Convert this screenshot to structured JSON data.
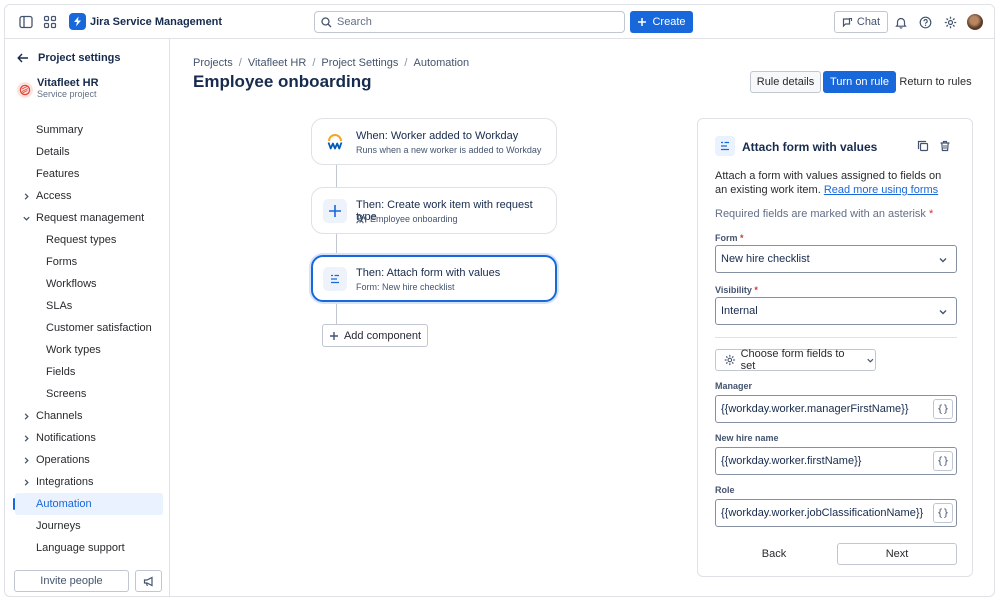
{
  "topbar": {
    "app_name": "Jira Service Management",
    "search_placeholder": "Search",
    "create_label": "Create",
    "chat_label": "Chat"
  },
  "sidebar": {
    "back_title": "Project settings",
    "project_name": "Vitafleet HR",
    "project_type": "Service project",
    "items": [
      {
        "label": "Summary",
        "level": 1
      },
      {
        "label": "Details",
        "level": 1
      },
      {
        "label": "Features",
        "level": 1
      },
      {
        "label": "Access",
        "level": 1,
        "chevron": "right"
      },
      {
        "label": "Request management",
        "level": 1,
        "chevron": "down"
      },
      {
        "label": "Request types",
        "level": 2
      },
      {
        "label": "Forms",
        "level": 2
      },
      {
        "label": "Workflows",
        "level": 2
      },
      {
        "label": "SLAs",
        "level": 2
      },
      {
        "label": "Customer satisfaction",
        "level": 2
      },
      {
        "label": "Work types",
        "level": 2
      },
      {
        "label": "Fields",
        "level": 2
      },
      {
        "label": "Screens",
        "level": 2
      },
      {
        "label": "Channels",
        "level": 1,
        "chevron": "right"
      },
      {
        "label": "Notifications",
        "level": 1,
        "chevron": "right"
      },
      {
        "label": "Operations",
        "level": 1,
        "chevron": "right"
      },
      {
        "label": "Integrations",
        "level": 1,
        "chevron": "right"
      },
      {
        "label": "Automation",
        "level": 1,
        "active": true
      },
      {
        "label": "Journeys",
        "level": 1
      },
      {
        "label": "Language support",
        "level": 1
      }
    ],
    "invite_label": "Invite people"
  },
  "main": {
    "breadcrumb": [
      "Projects",
      "Vitafleet HR",
      "Project Settings",
      "Automation"
    ],
    "breadcrumb_sep": "/",
    "title": "Employee onboarding",
    "rule_details_label": "Rule details",
    "turn_on_label": "Turn on rule",
    "return_label": "Return to rules"
  },
  "flow": {
    "trigger": {
      "title": "When: Worker added to Workday",
      "subtitle": "Runs when a new worker is added to Workday"
    },
    "action1": {
      "title": "Then: Create work item with request type",
      "subtitle": "Employee onboarding"
    },
    "action2": {
      "title": "Then: Attach form with values",
      "subtitle": "Form: New hire checklist"
    },
    "add_label": "Add component"
  },
  "panel": {
    "title": "Attach form with values",
    "desc": "Attach a form with values assigned to fields on an existing work item.",
    "desc_link": "Read more using forms",
    "required_note": "Required fields are marked with an asterisk",
    "asterisk": "*",
    "form_label": "Form",
    "form_value": "New hire checklist",
    "visibility_label": "Visibility",
    "visibility_value": "Internal",
    "choose_label": "Choose form fields to set",
    "fields": [
      {
        "label": "Manager",
        "value": "{{workday.worker.managerFirstName}}"
      },
      {
        "label": "New hire name",
        "value": "{{workday.worker.firstName}}"
      },
      {
        "label": "Role",
        "value": "{{workday.worker.jobClassificationName}}"
      }
    ],
    "brace_glyph": "{}",
    "back_label": "Back",
    "next_label": "Next"
  },
  "colors": {
    "brand": "#1868db",
    "active_bg": "#e9f2fe",
    "border": "#dfe1e6",
    "required": "#c9372c"
  }
}
